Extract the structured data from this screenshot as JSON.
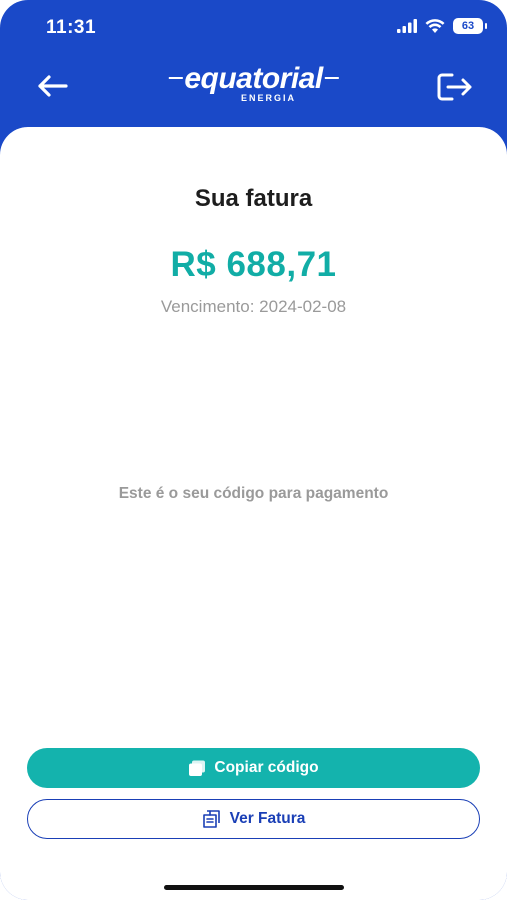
{
  "status_bar": {
    "time": "11:31",
    "battery": "63"
  },
  "header": {
    "logo_main": "equatorial",
    "logo_sub": "ENERGIA"
  },
  "invoice": {
    "title": "Sua fatura",
    "amount": "R$ 688,71",
    "due_date": "Vencimento: 2024-02-08",
    "code_label": "Este é o seu código para pagamento"
  },
  "actions": {
    "copy_label": "Copiar código",
    "view_label": "Ver Fatura"
  },
  "colors": {
    "header_blue": "#1a49c8",
    "accent_teal": "#14b3ad",
    "outline_blue": "#1a3fb6"
  }
}
